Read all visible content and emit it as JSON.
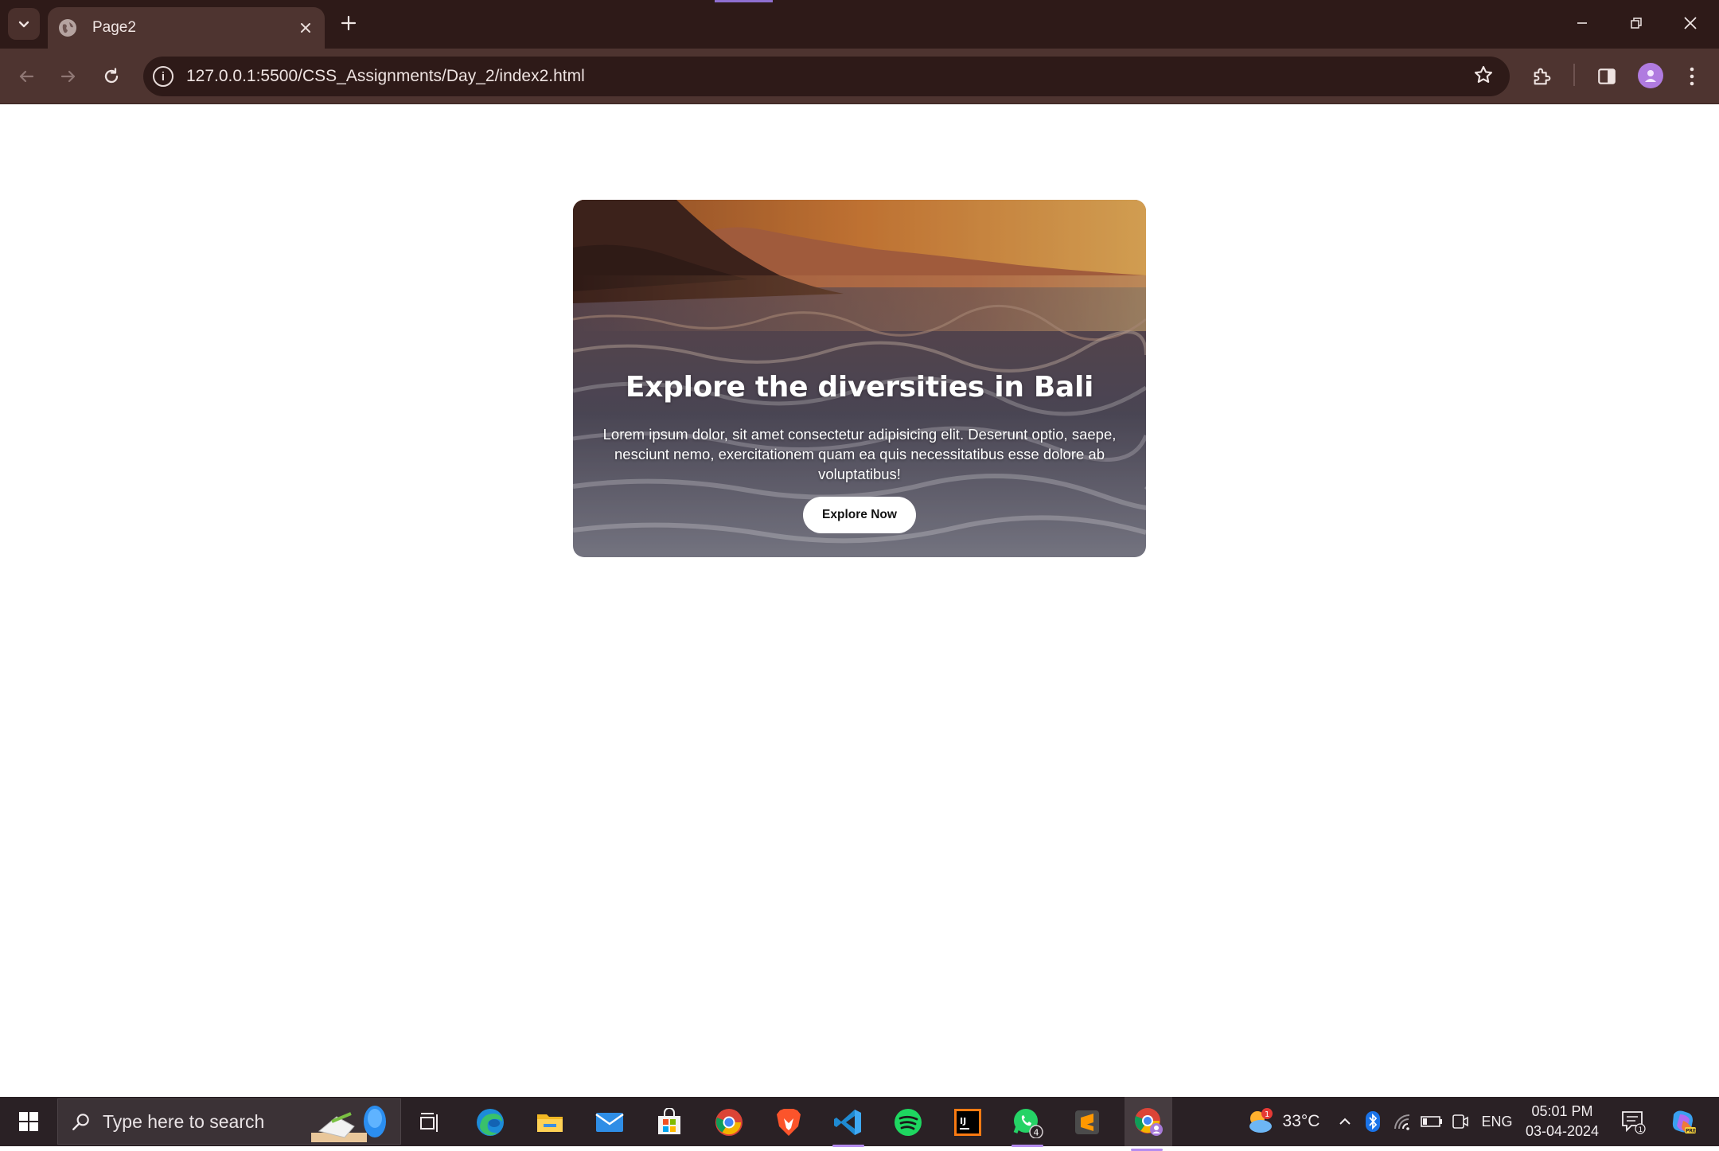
{
  "browser": {
    "tab": {
      "title": "Page2"
    },
    "address_bar": {
      "url": "127.0.0.1:5500/CSS_Assignments/Day_2/index2.html"
    }
  },
  "page": {
    "hero": {
      "heading": "Explore the diversities in Bali",
      "body": "Lorem ipsum dolor, sit amet consectetur adipisicing elit. Deserunt optio, saepe, nesciunt nemo, exercitationem quam ea quis necessitatibus esse dolore ab voluptatibus!",
      "button_label": "Explore Now"
    }
  },
  "taskbar": {
    "search_placeholder": "Type here to search",
    "apps": [
      "task-view",
      "edge",
      "file-explorer",
      "mail",
      "microsoft-store",
      "chrome",
      "brave",
      "vscode",
      "spotify",
      "intellij",
      "whatsapp",
      "sublime-text",
      "chrome-profile"
    ],
    "whatsapp_badge": "4",
    "weather": {
      "temperature": "33°C",
      "badge": "1"
    },
    "language": "ENG",
    "time": "05:01 PM",
    "date": "03-04-2024",
    "notifications_count": "1"
  },
  "colors": {
    "titlebar": "#2e1a18",
    "toolbar": "#4e3430",
    "taskbar": "#2a2125",
    "accent": "#b58cf0"
  }
}
